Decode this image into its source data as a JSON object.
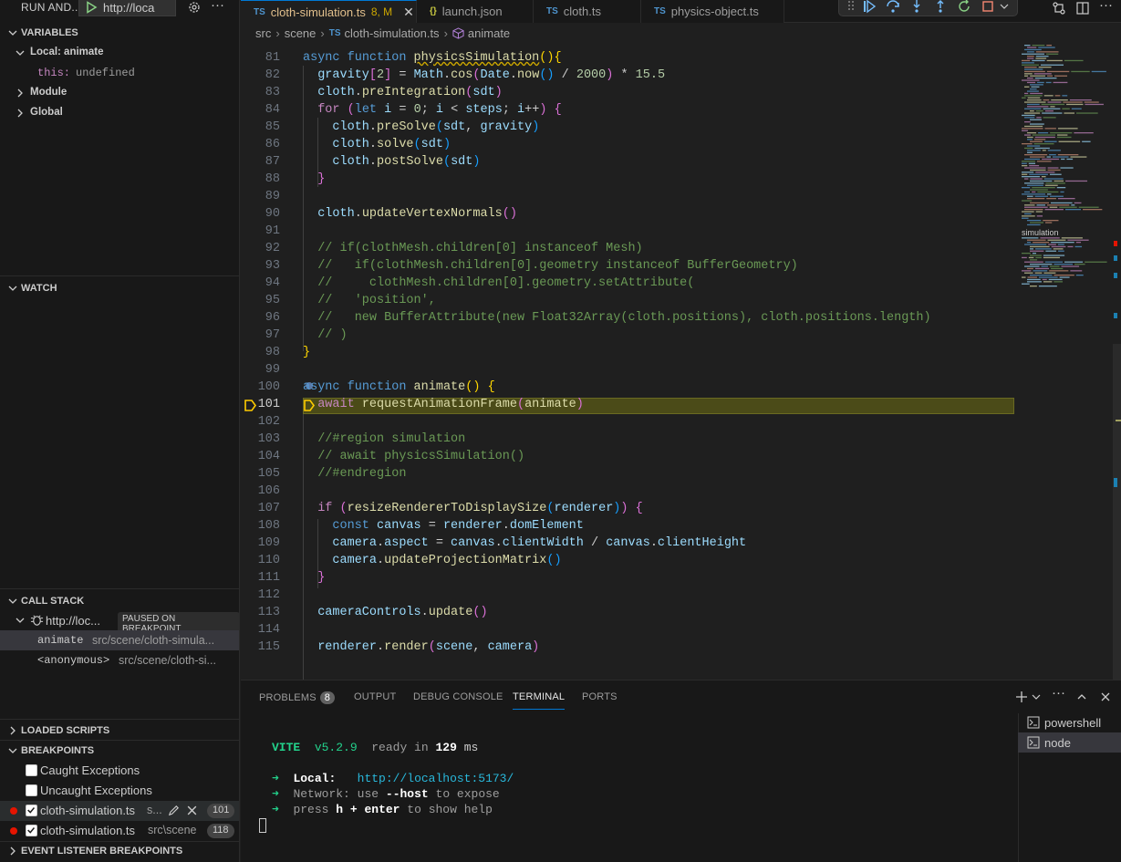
{
  "sidebar": {
    "run_label": "RUN AND...",
    "config_value": "http://loca",
    "variables": {
      "header": "VARIABLES",
      "scope_local": "Local: animate",
      "this_key": "this:",
      "this_value": "undefined",
      "scope_module": "Module",
      "scope_global": "Global"
    },
    "watch_header": "WATCH",
    "call_stack": {
      "header": "CALL STACK",
      "session": "http://loc...",
      "paused_badge": "PAUSED ON BREAKPOINT",
      "frames": [
        {
          "name": "animate",
          "path": "src/scene/cloth-simula..."
        },
        {
          "name": "<anonymous>",
          "path": "src/scene/cloth-si..."
        }
      ]
    },
    "loaded_scripts_header": "LOADED SCRIPTS",
    "breakpoints": {
      "header": "BREAKPOINTS",
      "caught": "Caught Exceptions",
      "uncaught": "Uncaught Exceptions",
      "items": [
        {
          "file": "cloth-simulation.ts",
          "path": "s...",
          "line": "101"
        },
        {
          "file": "cloth-simulation.ts",
          "path": "src\\scene",
          "line": "118"
        }
      ]
    },
    "event_listener_header": "EVENT LISTENER BREAKPOINTS"
  },
  "tabs": [
    {
      "label": "cloth-simulation.ts",
      "badge": "TS",
      "suffix": "8, M",
      "active": true
    },
    {
      "label": "launch.json",
      "badge": "{}"
    },
    {
      "label": "cloth.ts",
      "badge": "TS"
    },
    {
      "label": "physics-object.ts",
      "badge": "TS"
    }
  ],
  "breadcrumb": {
    "seg1": "src",
    "seg2": "scene",
    "seg3": "cloth-simulation.ts",
    "seg4": "animate",
    "ts": "TS"
  },
  "editor": {
    "line_numbers": [
      "81",
      "82",
      "83",
      "84",
      "85",
      "86",
      "87",
      "88",
      "89",
      "90",
      "91",
      "92",
      "93",
      "94",
      "95",
      "96",
      "97",
      "98",
      "99",
      "100",
      "101",
      "102",
      "103",
      "104",
      "105",
      "106",
      "107",
      "108",
      "109",
      "110",
      "111",
      "112",
      "113",
      "114",
      "115"
    ],
    "current_line": "101",
    "minimap_label": "simulation"
  },
  "panel": {
    "tabs": [
      "PROBLEMS",
      "OUTPUT",
      "DEBUG CONSOLE",
      "TERMINAL",
      "PORTS"
    ],
    "problems_count": "8",
    "terminal": {
      "vite": "VITE",
      "version": "v5.2.9",
      "ready": "ready in",
      "ms_value": "129",
      "ms_unit": "ms",
      "local_label": "Local:",
      "local_url": "http://localhost:5173/",
      "network_label": "Network:",
      "network_text1": "use",
      "network_flag": "--host",
      "network_text2": "to expose",
      "help_text1": "press",
      "help_key": "h + enter",
      "help_text2": "to show help"
    },
    "terminals": [
      "powershell",
      "node"
    ]
  },
  "colors": {
    "accent": "#0078d4",
    "breakpoint": "#e51400",
    "paused_line": "#4b4b18",
    "debug_arrow": "#ffcc00"
  }
}
